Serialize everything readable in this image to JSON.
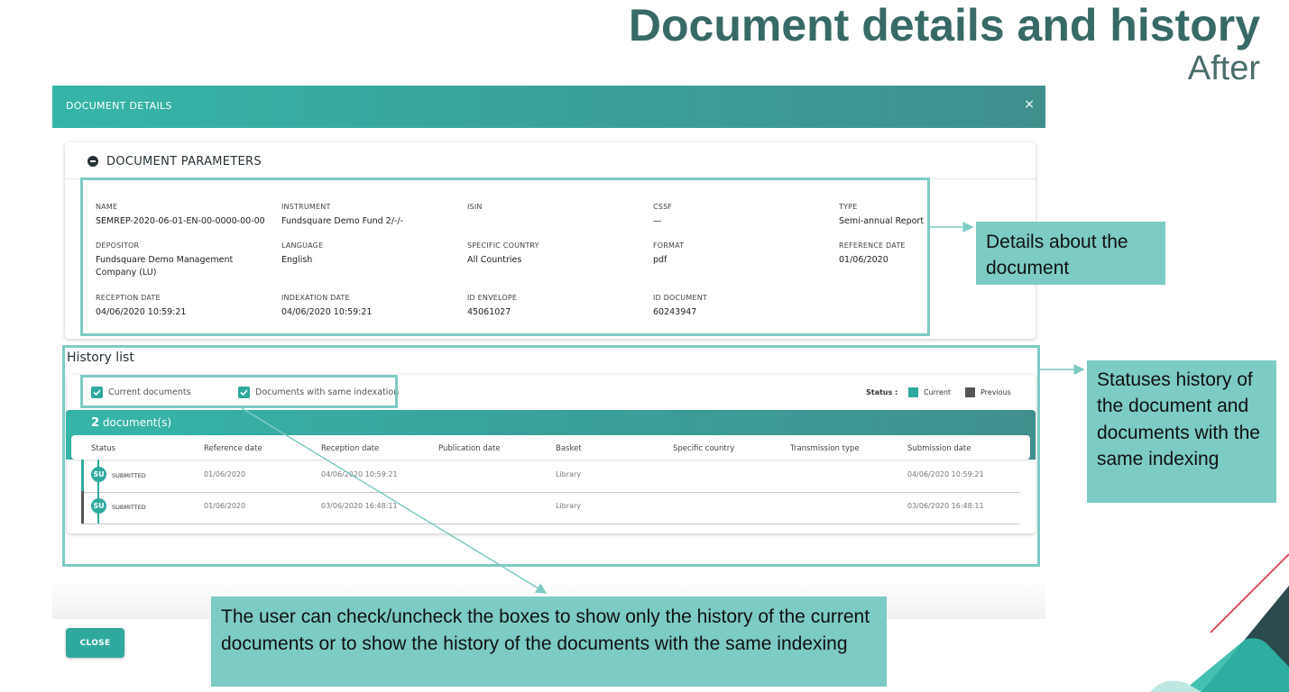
{
  "slide": {
    "title": "Document details and history",
    "subtitle": "After"
  },
  "modal": {
    "title": "DOCUMENT DETAILS",
    "close_icon": "×",
    "close_button": "CLOSE"
  },
  "parameters": {
    "heading": "DOCUMENT PARAMETERS",
    "name": {
      "label": "NAME",
      "value": "SEMREP-2020-06-01-EN-00-0000-00-00"
    },
    "instrument": {
      "label": "INSTRUMENT",
      "value": "Fundsquare Demo Fund 2/-/-"
    },
    "isin": {
      "label": "ISIN",
      "value": ""
    },
    "cssf": {
      "label": "CSSF",
      "value": "—"
    },
    "type": {
      "label": "TYPE",
      "value": "Semi-annual Report"
    },
    "depositor": {
      "label": "DEPOSITOR",
      "value": "Fundsquare Demo Management Company (LU)"
    },
    "language": {
      "label": "LANGUAGE",
      "value": "English"
    },
    "specific_country": {
      "label": "SPECIFIC COUNTRY",
      "value": "All Countries"
    },
    "format": {
      "label": "FORMAT",
      "value": "pdf"
    },
    "reference_date": {
      "label": "REFERENCE DATE",
      "value": "01/06/2020"
    },
    "reception_date": {
      "label": "RECEPTION DATE",
      "value": "04/06/2020 10:59:21"
    },
    "indexation_date": {
      "label": "INDEXATION DATE",
      "value": "04/06/2020 10:59:21"
    },
    "id_envelope": {
      "label": "ID ENVELOPE",
      "value": "45061027"
    },
    "id_document": {
      "label": "ID DOCUMENT",
      "value": "60243947"
    }
  },
  "history": {
    "title": "History list",
    "filters": {
      "current": "Current documents",
      "same_indexation": "Documents with same indexation"
    },
    "legend": {
      "label": "Status :",
      "current": "Current",
      "previous": "Previous",
      "current_color": "#2fa99e",
      "previous_color": "#555555"
    },
    "count_number": "2",
    "count_suffix": " document(s)",
    "columns": [
      "Status",
      "Reference date",
      "Reception date",
      "Publication date",
      "Basket",
      "Specific country",
      "Transmission type",
      "Submission date"
    ],
    "rows": [
      {
        "badge": "SU",
        "status": "SUBMITTED",
        "reference_date": "01/06/2020",
        "reception_date": "04/06/2020 10:59:21",
        "publication_date": "",
        "basket": "Library",
        "specific_country": "",
        "transmission_type": "",
        "submission_date": "04/06/2020 10:59:21",
        "kind": "current"
      },
      {
        "badge": "SU",
        "status": "SUBMITTED",
        "reference_date": "01/06/2020",
        "reception_date": "03/06/2020 16:48:11",
        "publication_date": "",
        "basket": "Library",
        "specific_country": "",
        "transmission_type": "",
        "submission_date": "03/06/2020 16:48:11",
        "kind": "previous"
      }
    ]
  },
  "callouts": {
    "details": "Details about the document",
    "statuses": "Statuses history of the document and documents with the same indexing",
    "checkboxes": "The user can check/uncheck the boxes to show only the history of the current documents or to show the history of the documents with the same indexing"
  },
  "colors": {
    "accent": "#2fa99e",
    "callout": "#7ccbc4",
    "title": "#376a66"
  }
}
